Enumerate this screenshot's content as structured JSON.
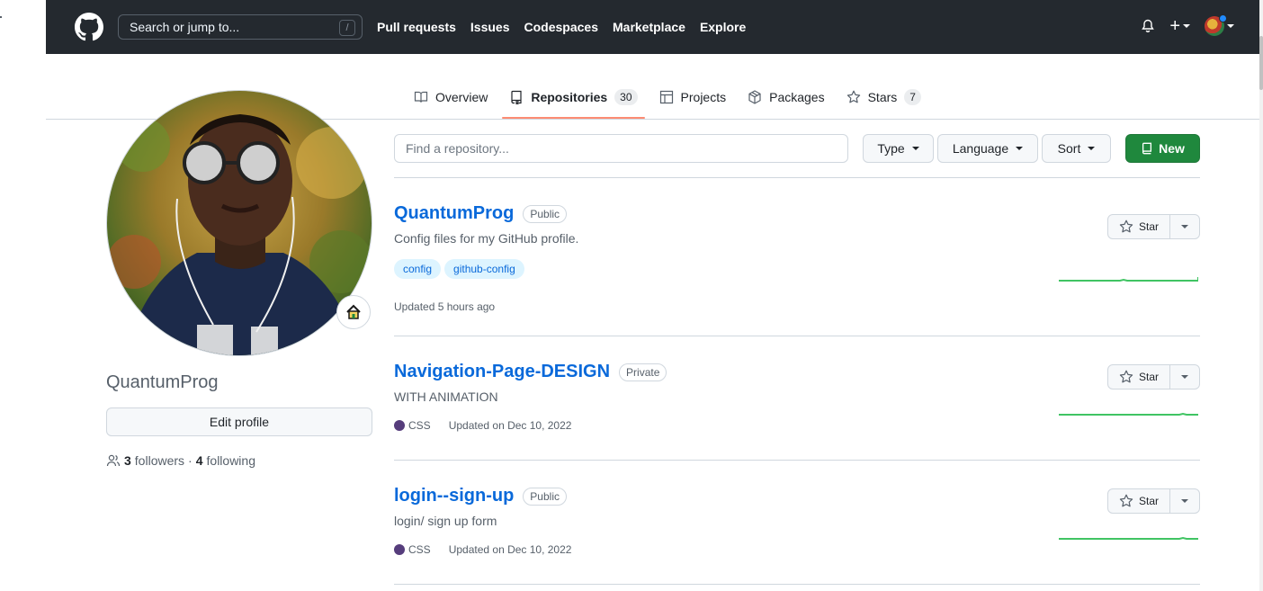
{
  "header": {
    "search_placeholder": "Search or jump to...",
    "search_shortcut": "/",
    "nav": [
      "Pull requests",
      "Issues",
      "Codespaces",
      "Marketplace",
      "Explore"
    ],
    "plus_label": "+"
  },
  "tabs": [
    {
      "label": "Overview",
      "icon": "book-icon"
    },
    {
      "label": "Repositories",
      "icon": "repo-icon",
      "count": "30",
      "active": true
    },
    {
      "label": "Projects",
      "icon": "table-icon"
    },
    {
      "label": "Packages",
      "icon": "package-icon"
    },
    {
      "label": "Stars",
      "icon": "star-icon",
      "count": "7"
    }
  ],
  "profile": {
    "username": "QuantumProg",
    "edit_label": "Edit profile",
    "followers_count": "3",
    "followers_label": "followers",
    "separator": "·",
    "following_count": "4",
    "following_label": "following",
    "status_icon": "house-icon"
  },
  "filters": {
    "find_placeholder": "Find a repository...",
    "type_label": "Type",
    "language_label": "Language",
    "sort_label": "Sort",
    "new_label": "New"
  },
  "repos": [
    {
      "name": "QuantumProg",
      "visibility": "Public",
      "description": "Config files for my GitHub profile.",
      "topics": [
        "config",
        "github-config"
      ],
      "language": "",
      "updated": "Updated 5 hours ago",
      "star_label": "Star"
    },
    {
      "name": "Navigation-Page-DESIGN",
      "visibility": "Private",
      "description": "WITH ANIMATION",
      "topics": [],
      "language": "CSS",
      "updated": "Updated on Dec 10, 2022",
      "star_label": "Star"
    },
    {
      "name": "login--sign-up",
      "visibility": "Public",
      "description": "login/ sign up form",
      "topics": [],
      "language": "CSS",
      "updated": "Updated on Dec 10, 2022",
      "star_label": "Star"
    }
  ],
  "colors": {
    "header_bg": "#24292f",
    "link": "#0969da",
    "new_button": "#1f883d",
    "tab_underline": "#fd8c73",
    "css_language": "#563d7c",
    "sparkline": "#40c463"
  }
}
